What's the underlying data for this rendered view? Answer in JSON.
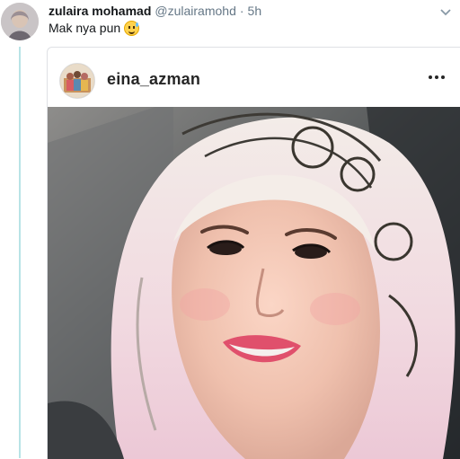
{
  "tweet": {
    "display_name": "zulaira mohamad",
    "handle": "@zulairamohd",
    "separator": "·",
    "time": "5h",
    "text": "Mak nya pun",
    "emoji_icon": "grinning-sweat-face-icon",
    "menu_icon": "chevron-down-icon"
  },
  "embed": {
    "username": "eina_azman",
    "more_icon": "more-dots-icon",
    "photo": "selfie-photo"
  },
  "colors": {
    "thread_line": "#b8e3e6",
    "name": "#14171a",
    "secondary_text": "#657786",
    "card_border": "#dfe1e5"
  }
}
